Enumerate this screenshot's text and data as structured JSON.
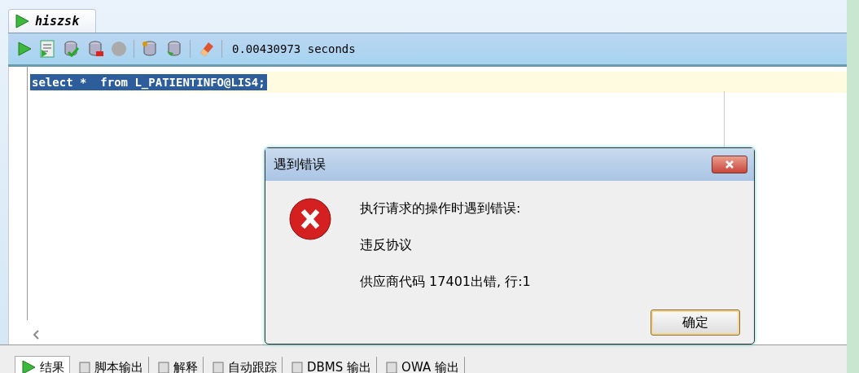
{
  "editor_tab": {
    "label": "hiszsk",
    "selected": true
  },
  "toolbar": {
    "timing": "0.00430973 seconds"
  },
  "editor": {
    "sql": "select *  from L_PATIENTINFO@LIS4;",
    "selected": true
  },
  "dialog": {
    "title": "遇到错误",
    "lines": [
      "执行请求的操作时遇到错误:",
      "违反协议",
      "供应商代码 17401出错, 行:1"
    ],
    "button": "确定"
  },
  "output_tabs": [
    {
      "label": "结果",
      "selected": true
    },
    {
      "label": "脚本输出",
      "selected": false
    },
    {
      "label": "解释",
      "selected": false
    },
    {
      "label": "自动跟踪",
      "selected": false
    },
    {
      "label": "DBMS 输出",
      "selected": false
    },
    {
      "label": "OWA 输出",
      "selected": false
    }
  ]
}
